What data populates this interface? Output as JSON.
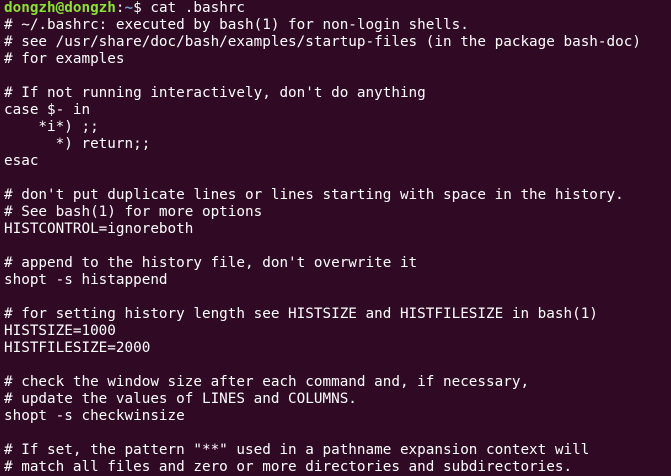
{
  "prompt": {
    "user_host": "dongzh@dongzh",
    "colon": ":",
    "path": "~",
    "symbol": "$ ",
    "command": "cat .bashrc"
  },
  "output_lines": [
    "# ~/.bashrc: executed by bash(1) for non-login shells.",
    "# see /usr/share/doc/bash/examples/startup-files (in the package bash-doc)",
    "# for examples",
    "",
    "# If not running interactively, don't do anything",
    "case $- in",
    "    *i*) ;;",
    "      *) return;;",
    "esac",
    "",
    "# don't put duplicate lines or lines starting with space in the history.",
    "# See bash(1) for more options",
    "HISTCONTROL=ignoreboth",
    "",
    "# append to the history file, don't overwrite it",
    "shopt -s histappend",
    "",
    "# for setting history length see HISTSIZE and HISTFILESIZE in bash(1)",
    "HISTSIZE=1000",
    "HISTFILESIZE=2000",
    "",
    "# check the window size after each command and, if necessary,",
    "# update the values of LINES and COLUMNS.",
    "shopt -s checkwinsize",
    "",
    "# If set, the pattern \"**\" used in a pathname expansion context will",
    "# match all files and zero or more directories and subdirectories."
  ],
  "colors": {
    "background": "#300a24",
    "prompt_user": "#8ae234",
    "prompt_path": "#729fcf",
    "text": "#ffffff"
  }
}
